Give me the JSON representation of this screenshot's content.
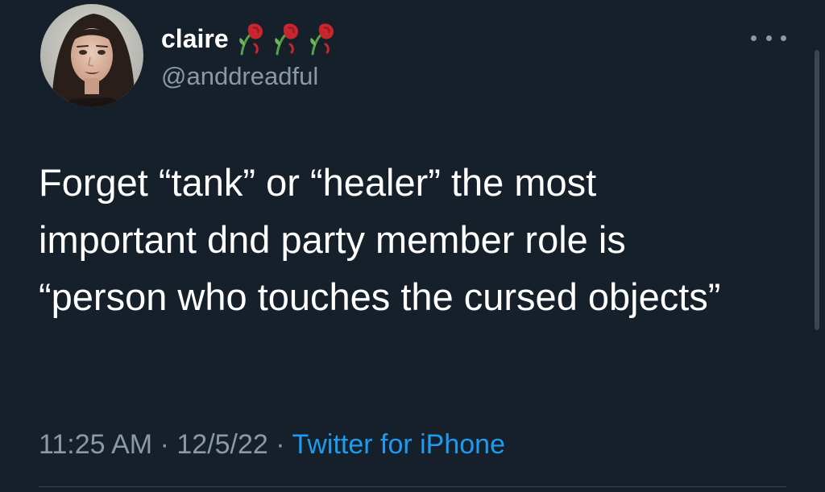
{
  "user": {
    "display_name": "claire",
    "handle": "@anddreadful",
    "name_emojis": [
      "wilted-rose-icon",
      "wilted-rose-icon",
      "wilted-rose-icon"
    ]
  },
  "tweet": {
    "text": "Forget “tank” or “healer” the most important dnd party member role is “person who touches the cursed objects”",
    "time": "11:25 AM",
    "date": "12/5/22",
    "separator": "·",
    "source": "Twitter for iPhone"
  },
  "colors": {
    "background": "#15202b",
    "primary_text": "#ffffff",
    "secondary_text": "#8b98a5",
    "link": "#1d9bf0"
  },
  "icons": {
    "more": "more-horizontal-icon"
  }
}
